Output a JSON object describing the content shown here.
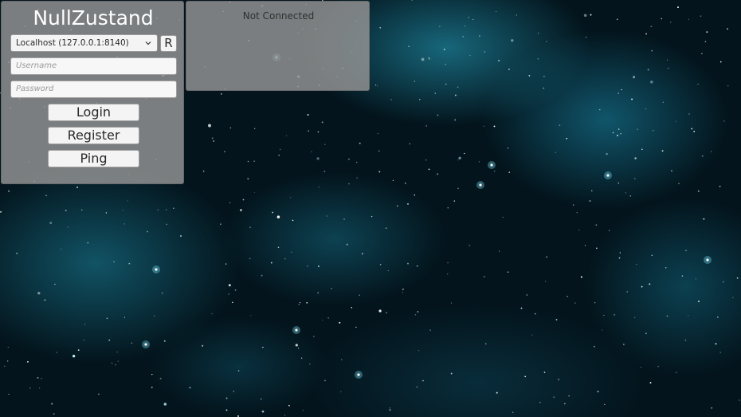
{
  "login": {
    "title": "NullZustand",
    "server_select": {
      "selected": "Localhost (127.0.0.1:8140)",
      "icon": "chevron-down-icon"
    },
    "refresh_label": "R",
    "username_placeholder": "Username",
    "password_placeholder": "Password",
    "login_label": "Login",
    "register_label": "Register",
    "ping_label": "Ping"
  },
  "status": {
    "text": "Not Connected"
  },
  "colors": {
    "panel": "#969696",
    "background": "#03141c",
    "nebula": "#28aac8"
  }
}
